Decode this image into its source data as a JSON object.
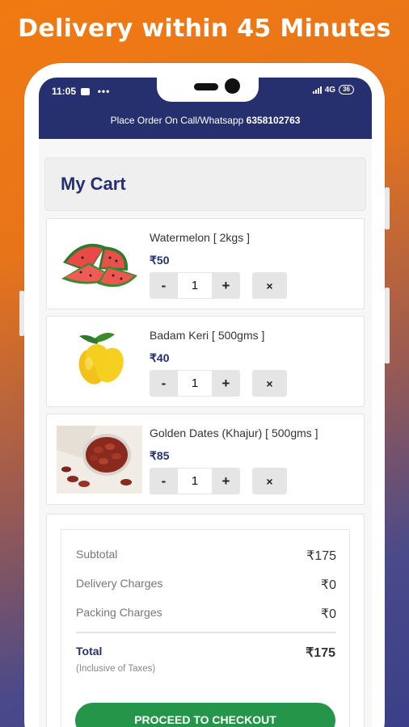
{
  "headline": "Delivery within 45 Minutes",
  "status_bar": {
    "time": "11:05",
    "network": "4G",
    "battery": "36"
  },
  "order_banner": {
    "prefix": "Place Order On Call/Whatsapp",
    "phone": "6358102763"
  },
  "cart_title": "My Cart",
  "currency": "₹",
  "items": [
    {
      "name": "Watermelon [ 2kgs ]",
      "price": "₹50",
      "quantity": "1",
      "image": "watermelon-image"
    },
    {
      "name": "Badam Keri [ 500gms ]",
      "price": "₹40",
      "quantity": "1",
      "image": "mango-image"
    },
    {
      "name": "Golden Dates (Khajur) [ 500gms ]",
      "price": "₹85",
      "quantity": "1",
      "image": "dates-image"
    }
  ],
  "qty_controls": {
    "minus": "-",
    "plus": "+",
    "remove": "×"
  },
  "summary": {
    "subtotal_label": "Subtotal",
    "subtotal_value": "₹175",
    "delivery_label": "Delivery Charges",
    "delivery_value": "₹0",
    "packing_label": "Packing Charges",
    "packing_value": "₹0",
    "total_label": "Total",
    "total_value": "₹175",
    "tax_note": "(Inclusive of Taxes)"
  },
  "checkout_label": "PROCEED TO CHECKOUT",
  "colors": {
    "brand_navy": "#27306e",
    "checkout_green": "#25954a",
    "background_orange": "#f07a12",
    "background_blue": "#3a3f88"
  }
}
